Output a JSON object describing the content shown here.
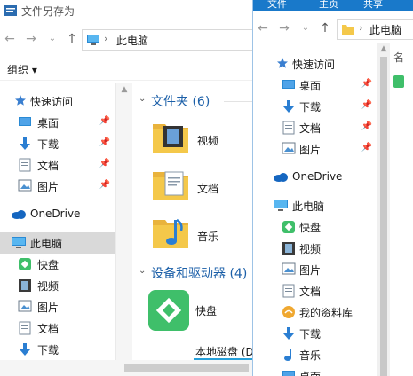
{
  "left_window": {
    "title": "文件另存为",
    "address": {
      "path": "此电脑"
    },
    "toolbar": {
      "organize_label": "组织",
      "organize_arrow": "▾"
    },
    "nav": [
      {
        "label": "快速访问",
        "icon": "star-icon",
        "pinned": false
      },
      {
        "label": "桌面",
        "icon": "desktop-icon",
        "pinned": true
      },
      {
        "label": "下载",
        "icon": "download-icon",
        "pinned": true
      },
      {
        "label": "文档",
        "icon": "document-icon",
        "pinned": true
      },
      {
        "label": "图片",
        "icon": "picture-icon",
        "pinned": true
      },
      {
        "label": "OneDrive",
        "icon": "onedrive-icon",
        "pinned": false
      },
      {
        "label": "此电脑",
        "icon": "computer-icon",
        "pinned": false,
        "selected": true
      },
      {
        "label": "快盘",
        "icon": "kuaipan-icon",
        "pinned": false
      },
      {
        "label": "视频",
        "icon": "video-icon",
        "pinned": false
      },
      {
        "label": "图片",
        "icon": "picture-icon",
        "pinned": false
      },
      {
        "label": "文档",
        "icon": "document-icon",
        "pinned": false
      },
      {
        "label": "下载",
        "icon": "download-icon",
        "pinned": false
      }
    ],
    "content": {
      "folders_group": "文件夹 (6)",
      "folders": [
        {
          "label": "视频",
          "icon": "video-folder-icon"
        },
        {
          "label": "文档",
          "icon": "document-folder-icon"
        },
        {
          "label": "音乐",
          "icon": "music-folder-icon"
        }
      ],
      "devices_group": "设备和驱动器 (4)",
      "devices": [
        {
          "label": "快盘",
          "icon": "kuaipan-icon"
        }
      ],
      "drive_partial_label": "本地磁盘 (D"
    }
  },
  "right_window": {
    "ribbon_tabs": [
      "文件",
      "主页",
      "共享"
    ],
    "address": {
      "path": "此电脑"
    },
    "nav": [
      {
        "label": "快速访问",
        "icon": "star-icon",
        "pinned": false
      },
      {
        "label": "桌面",
        "icon": "desktop-icon",
        "pinned": true
      },
      {
        "label": "下载",
        "icon": "download-icon",
        "pinned": true
      },
      {
        "label": "文档",
        "icon": "document-icon",
        "pinned": true
      },
      {
        "label": "图片",
        "icon": "picture-icon",
        "pinned": true
      },
      {
        "label": "OneDrive",
        "icon": "onedrive-icon",
        "pinned": false
      },
      {
        "label": "此电脑",
        "icon": "computer-icon",
        "pinned": false
      },
      {
        "label": "快盘",
        "icon": "kuaipan-icon",
        "pinned": false
      },
      {
        "label": "视频",
        "icon": "video-icon",
        "pinned": false
      },
      {
        "label": "图片",
        "icon": "picture-icon",
        "pinned": false
      },
      {
        "label": "文档",
        "icon": "document-icon",
        "pinned": false
      },
      {
        "label": "我的资料库",
        "icon": "library-icon",
        "pinned": false
      },
      {
        "label": "下载",
        "icon": "download-icon",
        "pinned": false
      },
      {
        "label": "音乐",
        "icon": "music-icon",
        "pinned": false
      },
      {
        "label": "桌面",
        "icon": "desktop-icon",
        "pinned": false
      }
    ],
    "content_partial_label": "名"
  },
  "colors": {
    "ribbon_blue": "#1979ca",
    "group_header_blue": "#1b5fa8",
    "selected_bg": "#d9d9d9",
    "folder_yellow": "#f4c84a",
    "kuaipan_green": "#3fbf6a",
    "onedrive_blue": "#1566c0"
  }
}
